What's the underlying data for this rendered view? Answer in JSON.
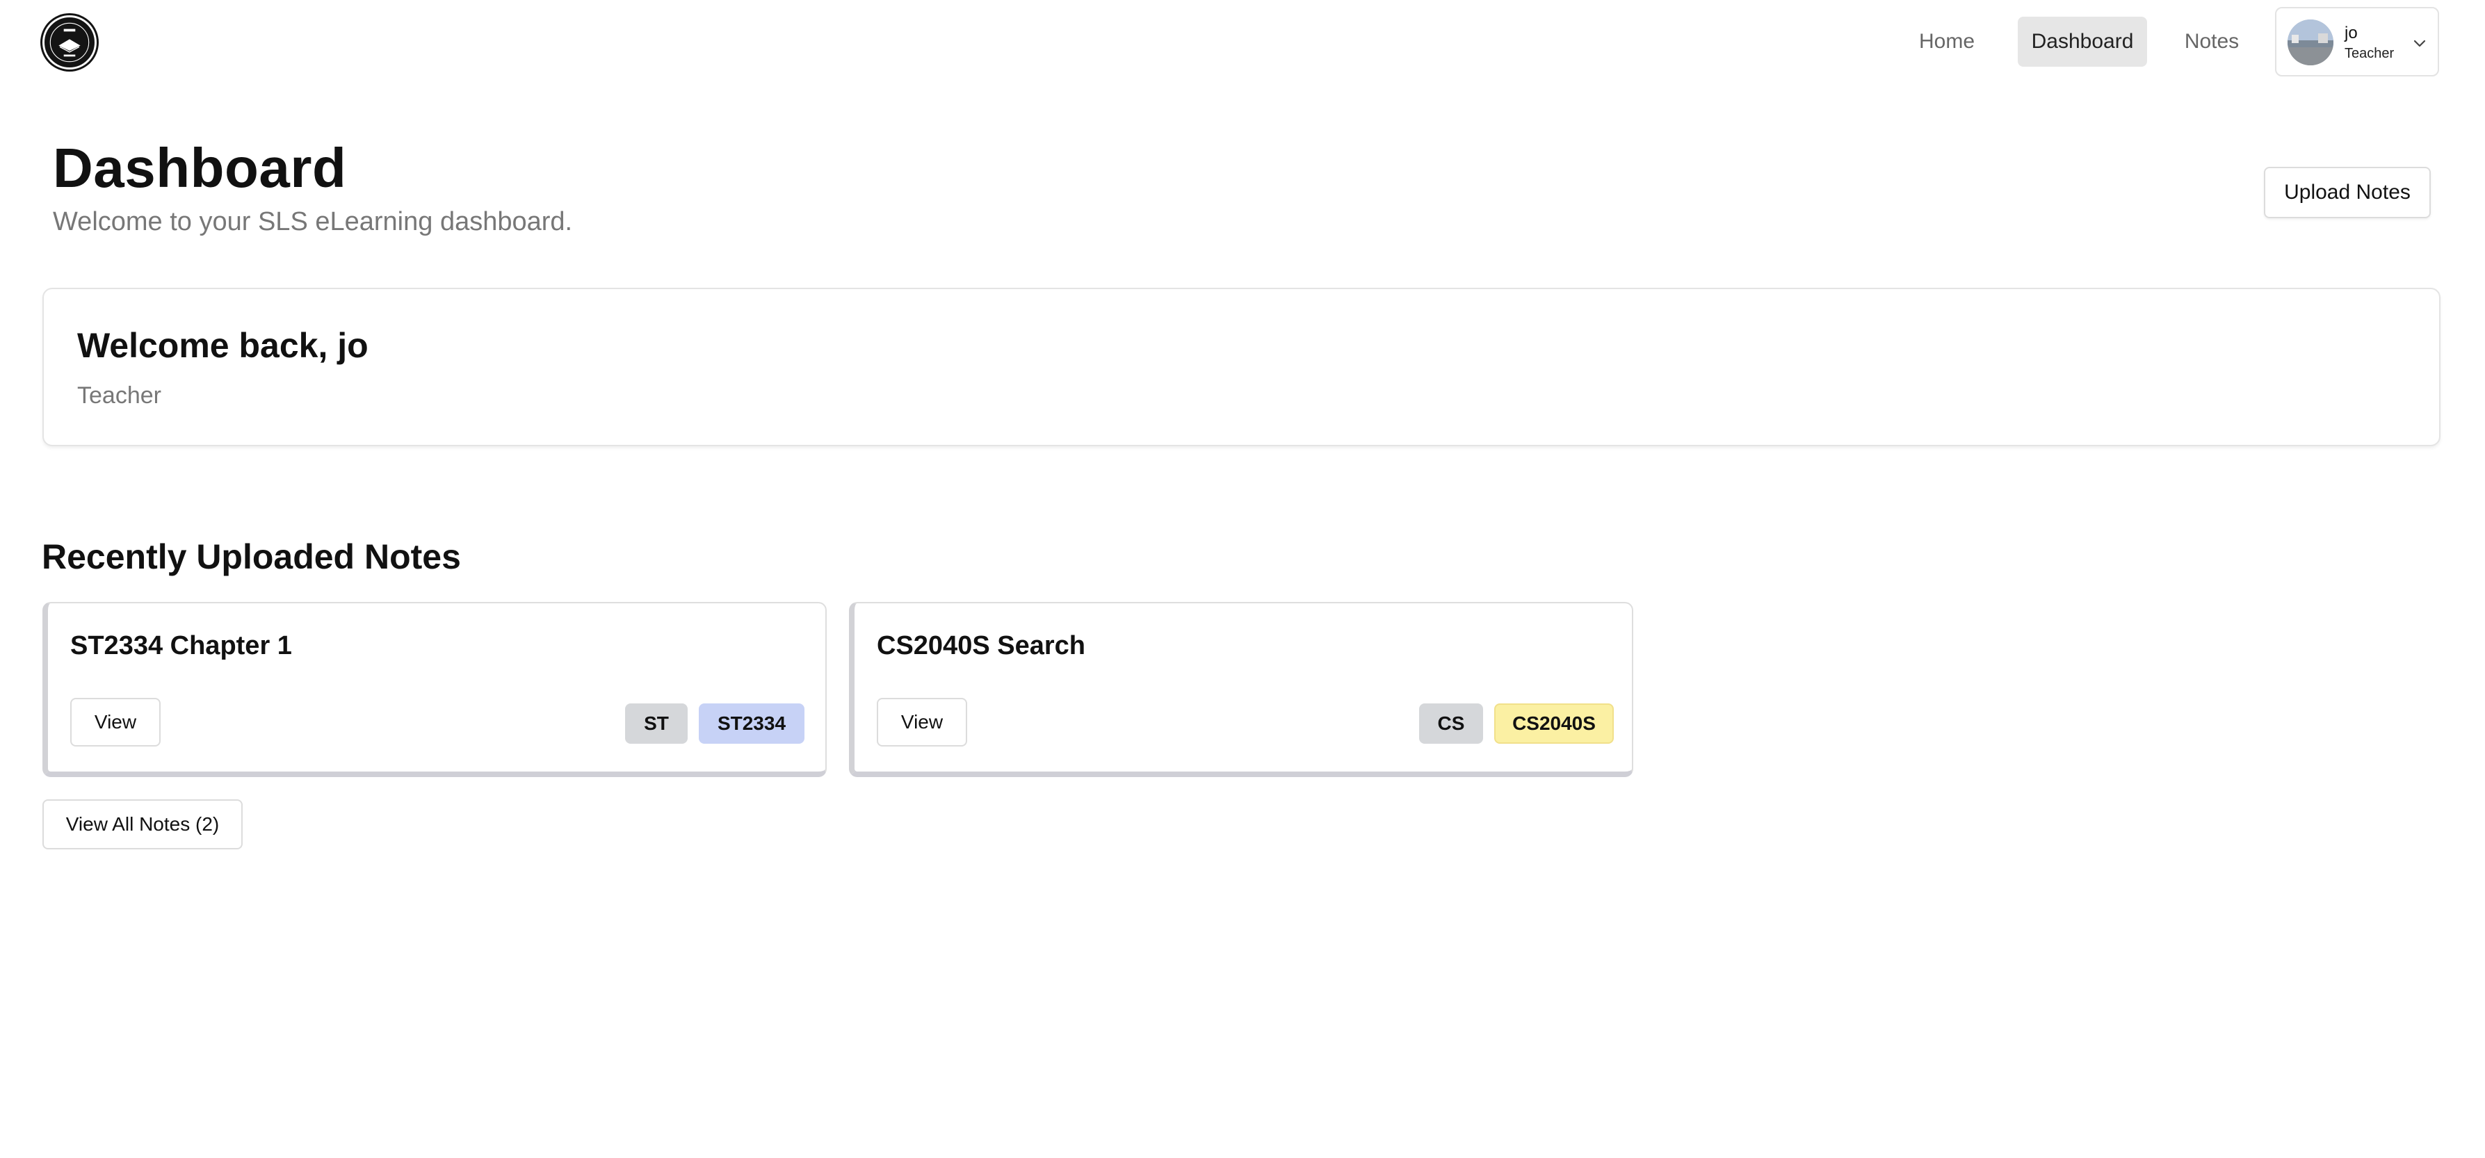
{
  "header": {
    "logo_icon": "school-crest-logo-icon",
    "nav": [
      {
        "label": "Home",
        "active": false
      },
      {
        "label": "Dashboard",
        "active": true
      },
      {
        "label": "Notes",
        "active": false
      }
    ],
    "user": {
      "name": "jo",
      "role": "Teacher",
      "avatar_icon": "avatar-photo",
      "menu_icon": "chevron-down-icon"
    }
  },
  "page": {
    "title": "Dashboard",
    "subtitle": "Welcome to your SLS eLearning dashboard.",
    "upload_label": "Upload Notes"
  },
  "welcome": {
    "title": "Welcome back, jo",
    "role": "Teacher"
  },
  "recent": {
    "title": "Recently Uploaded Notes",
    "notes": [
      {
        "title": "ST2334 Chapter 1",
        "view_label": "View",
        "tags": [
          "ST",
          "ST2334"
        ]
      },
      {
        "title": "CS2040S Search",
        "view_label": "View",
        "tags": [
          "CS",
          "CS2040S"
        ]
      }
    ],
    "view_all_label": "View All Notes (2)"
  },
  "colors": {
    "active_nav_bg": "#e6e6e6",
    "tag_grey": "#d5d7da",
    "tag_blue": "#c7d2f6",
    "tag_yellow": "#fbf0a3"
  }
}
